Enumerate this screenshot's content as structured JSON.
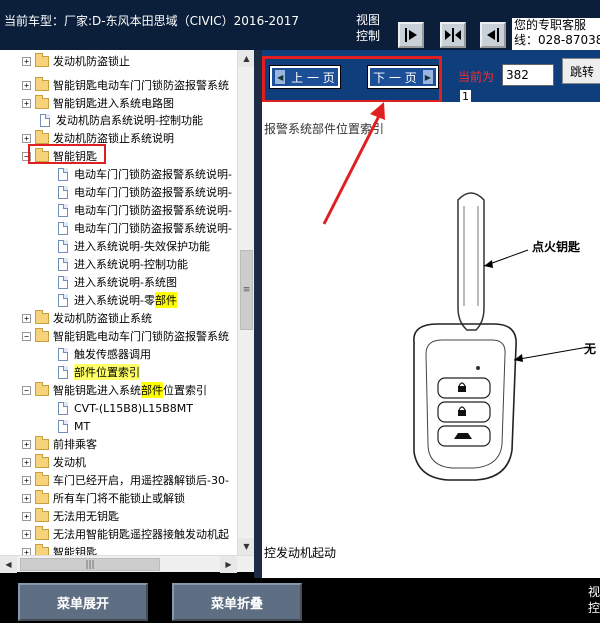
{
  "header": {
    "title": "当前车型：厂家:D-东风本田思域（CIVIC）2016-2017",
    "view_label": "视图控制",
    "service_line1": "您的专职客服",
    "service_line2": "线：028-87038"
  },
  "tree": {
    "items": [
      {
        "label": "发动机防盗锁止"
      },
      {
        "label": "智能钥匙电动车门门锁防盗报警系统"
      },
      {
        "label": "智能钥匙进入系统电路图"
      },
      {
        "label": "发动机防启系统说明-控制功能"
      },
      {
        "label": "发动机防盗锁止系统说明"
      },
      {
        "label": "智能钥匙"
      },
      {
        "label": "电动车门门锁防盗报警系统说明-"
      },
      {
        "label": "电动车门门锁防盗报警系统说明-"
      },
      {
        "label": "电动车门门锁防盗报警系统说明-"
      },
      {
        "label": "电动车门门锁防盗报警系统说明-"
      },
      {
        "label": "进入系统说明-失效保护功能"
      },
      {
        "label": "进入系统说明-控制功能"
      },
      {
        "label": "进入系统说明-系统图"
      },
      {
        "label": "进入系统说明-零",
        "highlight": "部件"
      },
      {
        "label": "发动机防盗锁止系统"
      },
      {
        "label": "智能钥匙电动车门门锁防盗报警系统"
      },
      {
        "label": "触发传感器调用"
      },
      {
        "label": "部件位置索引"
      },
      {
        "label": "智能钥匙进入系统",
        "highlight": "部件",
        "suffix": "位置索引"
      },
      {
        "label": "CVT-(L15B8)L15B8MT"
      },
      {
        "label": "MT"
      },
      {
        "label": "前排乘客"
      },
      {
        "label": "发动机"
      },
      {
        "label": "车门已经开启，用遥控器解锁后-30-"
      },
      {
        "label": "所有车门将不能锁止或解锁"
      },
      {
        "label": "无法用无钥匙"
      },
      {
        "label": "无法用智能钥匙遥控器接触发动机起"
      },
      {
        "label": "智能钥匙"
      }
    ]
  },
  "nav": {
    "prev_label": "上 一 页",
    "next_label": "下 一 页",
    "current_label": "当前为",
    "page_value": "382",
    "jump_label": "跳转",
    "page_sub": "1"
  },
  "document": {
    "heading": "报警系统部件位置索引",
    "callout_key": "点火钥匙",
    "callout_right": "无",
    "footer": "控发动机起动"
  },
  "bottom": {
    "expand_label": "菜单展开",
    "collapse_label": "菜单折叠",
    "right_label": "视控"
  },
  "colors": {
    "annotation_red": "#e02020",
    "highlight_yellow": "#ffff00",
    "nav_blue": "#0e3f7c"
  }
}
